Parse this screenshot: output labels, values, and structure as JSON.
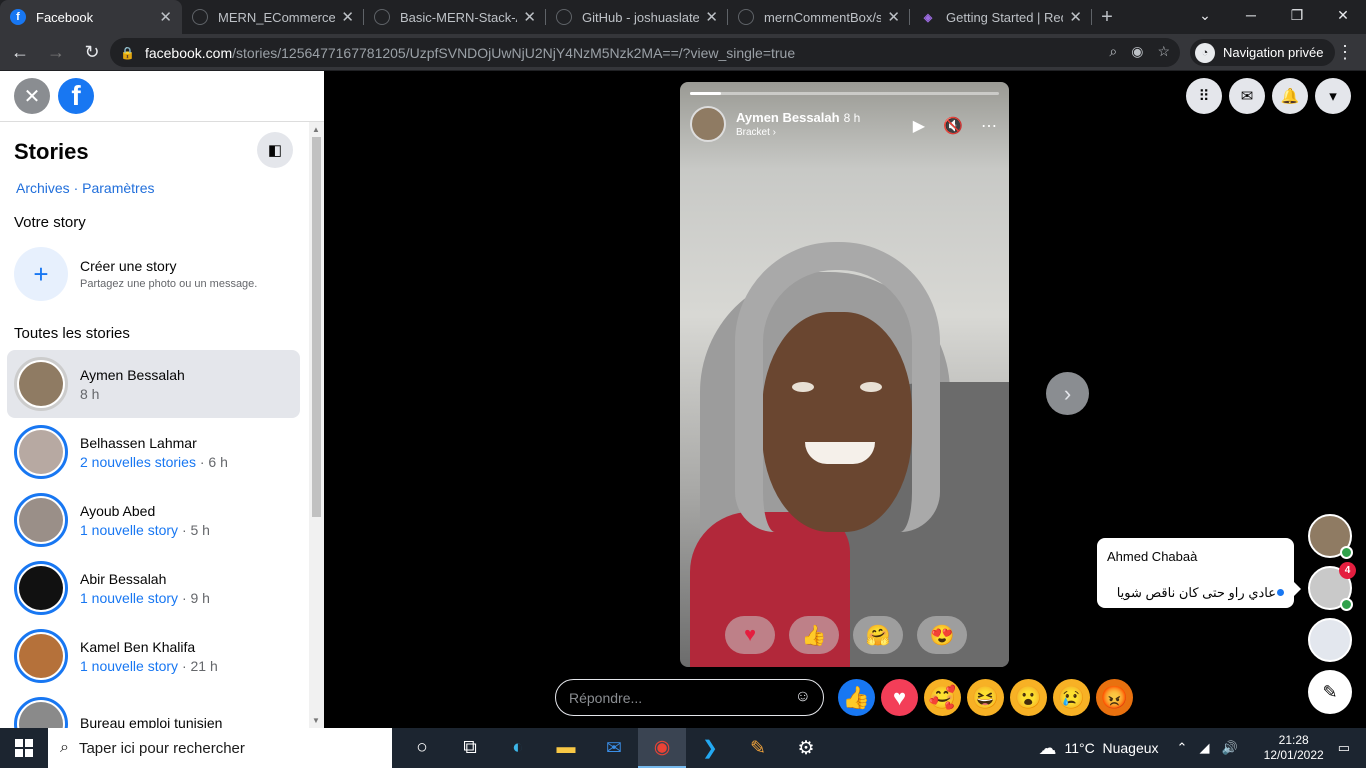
{
  "browser": {
    "tabs": [
      {
        "title": "Facebook",
        "active": true,
        "icon": "facebook-icon"
      },
      {
        "title": "MERN_ECommerce_Ap",
        "icon": "github-icon"
      },
      {
        "title": "Basic-MERN-Stack-Ap",
        "icon": "github-icon"
      },
      {
        "title": "GitHub - joshuaslate/r",
        "icon": "github-icon"
      },
      {
        "title": "mernCommentBox/src",
        "icon": "github-icon"
      },
      {
        "title": "Getting Started | Redu",
        "icon": "redux-icon"
      }
    ],
    "url_domain": "facebook.com",
    "url_path": "/stories/1256477167781205/UzpfSVNDOjUwNjU2NjY4NzM5Nzk2MA==/?view_single=true",
    "private_label": "Navigation privée"
  },
  "sidebar": {
    "title": "Stories",
    "links": [
      "Archives",
      "Paramètres"
    ],
    "your_story_heading": "Votre story",
    "create_title": "Créer une story",
    "create_subtitle": "Partagez une photo ou un message.",
    "all_stories_heading": "Toutes les stories",
    "stories": [
      {
        "name": "Aymen Bessalah",
        "new": "",
        "time": "8 h",
        "selected": true,
        "color": "#8f7b63"
      },
      {
        "name": "Belhassen Lahmar",
        "new": "2 nouvelles stories",
        "time": " · 6 h",
        "color": "#b7a9a2"
      },
      {
        "name": "Ayoub Abed",
        "new": "1 nouvelle story",
        "time": " · 5 h",
        "color": "#9a8f88"
      },
      {
        "name": "Abir Bessalah",
        "new": "1 nouvelle story",
        "time": " · 9 h",
        "color": "#111111"
      },
      {
        "name": "Kamel Ben Khalifa",
        "new": "1 nouvelle story",
        "time": " · 21 h",
        "color": "#b5713a"
      },
      {
        "name": "Bureau emploi tunisien",
        "new": "",
        "time": "",
        "color": "#8a8a8a"
      }
    ]
  },
  "viewer": {
    "author": "Aymen Bessalah",
    "time": "8 h",
    "subtitle": "Bracket",
    "progress": 0.1,
    "quick_reactions": [
      "♥",
      "👍",
      "🤗",
      "😍"
    ]
  },
  "reply": {
    "placeholder": "Répondre...",
    "reactions": [
      "👍",
      "♥",
      "🥰",
      "😆",
      "😮",
      "😢",
      "😡"
    ],
    "reaction_colors": [
      "#1877f2",
      "#f33e58",
      "#f7b125",
      "#f7b125",
      "#f7b125",
      "#f7b125",
      "#e9710f"
    ]
  },
  "chat": {
    "name": "Ahmed Chabaà",
    "message": "عادي راو حتى كان ناقص شويا",
    "badge": "4"
  },
  "taskbar": {
    "search_placeholder": "Taper ici pour rechercher",
    "temperature": "11°C",
    "weather": "Nuageux",
    "time": "21:28",
    "date": "12/01/2022"
  }
}
